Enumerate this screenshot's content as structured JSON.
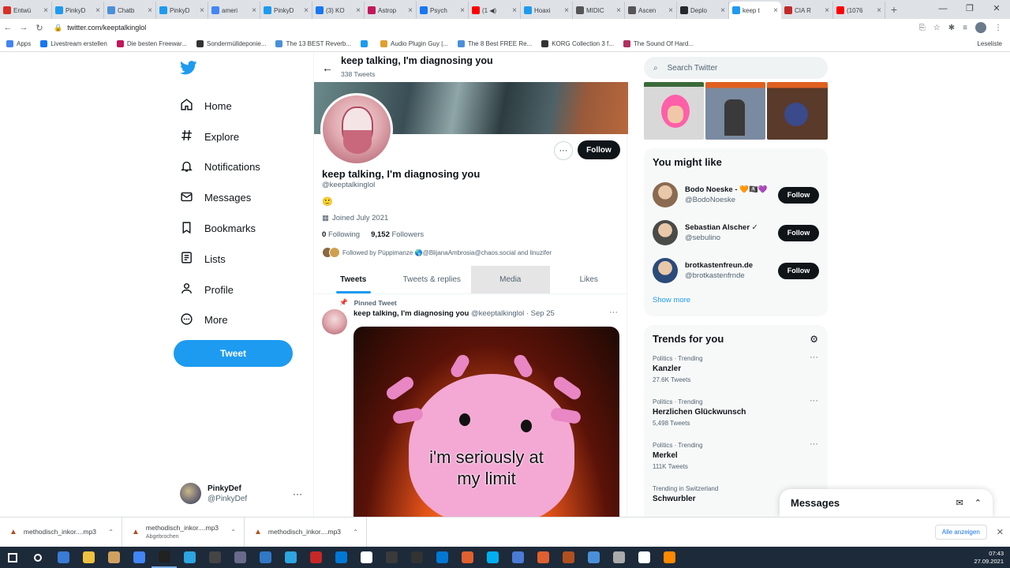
{
  "browser": {
    "tabs": [
      {
        "title": "Entwü",
        "color": "#d93025"
      },
      {
        "title": "PinkyD",
        "color": "#1d9bf0"
      },
      {
        "title": "Chatb",
        "color": "#4a90d9"
      },
      {
        "title": "PinkyD",
        "color": "#1d9bf0"
      },
      {
        "title": "ameri",
        "color": "#4285f4"
      },
      {
        "title": "PinkyD",
        "color": "#1d9bf0"
      },
      {
        "title": "(3) KO",
        "color": "#1877f2"
      },
      {
        "title": "Astrop",
        "color": "#c2185b"
      },
      {
        "title": "Psych",
        "color": "#1877f2"
      },
      {
        "title": "(1 ◀)",
        "color": "#ff0000"
      },
      {
        "title": "Hoaxi",
        "color": "#1d9bf0"
      },
      {
        "title": "MIDIC",
        "color": "#555555"
      },
      {
        "title": "Ascen",
        "color": "#555555"
      },
      {
        "title": "Deplo",
        "color": "#24292f"
      },
      {
        "title": "keep t",
        "color": "#1d9bf0",
        "active": true
      },
      {
        "title": "CIA R",
        "color": "#c62828"
      },
      {
        "title": "(1076",
        "color": "#ff0000"
      }
    ],
    "url": "twitter.com/keeptalkinglol",
    "bookmarks": [
      {
        "label": "Apps",
        "color": "#4285f4"
      },
      {
        "label": "Livestream erstellen",
        "color": "#1877f2"
      },
      {
        "label": "Die besten Freewar...",
        "color": "#c2185b"
      },
      {
        "label": "Sondermülldeponie...",
        "color": "#333333"
      },
      {
        "label": "The 13 BEST Reverb...",
        "color": "#4a90d9"
      },
      {
        "label": "",
        "color": "#1d9bf0"
      },
      {
        "label": "Audio Plugin Guy |...",
        "color": "#e0a030"
      },
      {
        "label": "The 8 Best FREE Re...",
        "color": "#4a90d9"
      },
      {
        "label": "KORG Collection 3 f...",
        "color": "#333333"
      },
      {
        "label": "The Sound Of Hard...",
        "color": "#b03060"
      }
    ],
    "reading_list": "Leseliste"
  },
  "nav": {
    "items": [
      {
        "label": "Home",
        "icon": "home-icon"
      },
      {
        "label": "Explore",
        "icon": "hashtag-icon"
      },
      {
        "label": "Notifications",
        "icon": "bell-icon"
      },
      {
        "label": "Messages",
        "icon": "envelope-icon"
      },
      {
        "label": "Bookmarks",
        "icon": "bookmark-icon"
      },
      {
        "label": "Lists",
        "icon": "list-icon"
      },
      {
        "label": "Profile",
        "icon": "person-icon"
      },
      {
        "label": "More",
        "icon": "more-circle-icon"
      }
    ],
    "tweet_label": "Tweet",
    "account": {
      "name": "PinkyDef",
      "handle": "@PinkyDef",
      "more": "···"
    }
  },
  "profile": {
    "header_title": "keep talking, I'm diagnosing you",
    "header_count": "338 Tweets",
    "name": "keep talking, I'm diagnosing you",
    "handle": "@keeptalkinglol",
    "bio": "🙂",
    "joined": "Joined July 2021",
    "following_count": "0",
    "following_label": "Following",
    "followers_count": "9,152",
    "followers_label": "Followers",
    "followed_by": "Followed by Püppimanze 🌎@BlijanaAmbrosia@chaos.social and linuzifer",
    "follow_label": "Follow",
    "more_label": "···",
    "tabs": [
      "Tweets",
      "Tweets & replies",
      "Media",
      "Likes"
    ]
  },
  "tweet": {
    "pinned_label": "Pinned Tweet",
    "author": "keep talking, I'm diagnosing you",
    "handle": "@keeptalkinglol",
    "date": "· Sep 25",
    "more": "···",
    "image_caption_line1": "i'm seriously at",
    "image_caption_line2": "my limit"
  },
  "sidebar": {
    "search_placeholder": "Search Twitter",
    "you_might_like_title": "You might like",
    "suggestions": [
      {
        "name": "Bodo Noeske - 🧡🏴‍☠️💜",
        "handle": "@BodoNoeske",
        "avatar_color": "#8a6a50"
      },
      {
        "name": "Sebastian Alscher ✓",
        "handle": "@sebulino",
        "avatar_color": "#4a4a48"
      },
      {
        "name": "brotkastenfreun.de",
        "handle": "@brotkastenfrnde",
        "avatar_color": "#2a4a7a"
      }
    ],
    "follow_label": "Follow",
    "show_more": "Show more",
    "trends_title": "Trends for you",
    "trends": [
      {
        "category": "Politics · Trending",
        "name": "Kanzler",
        "count": "27.6K Tweets"
      },
      {
        "category": "Politics · Trending",
        "name": "Herzlichen Glückwunsch",
        "count": "5,498 Tweets"
      },
      {
        "category": "Politics · Trending",
        "name": "Merkel",
        "count": "111K Tweets"
      },
      {
        "category": "Trending in Switzerland",
        "name": "Schwurbler",
        "count": ""
      }
    ],
    "messages_title": "Messages"
  },
  "downloads": {
    "items": [
      {
        "name": "methodisch_inkor....mp3",
        "status": ""
      },
      {
        "name": "methodisch_inkor....mp3",
        "status": "Abgebrochen"
      },
      {
        "name": "methodisch_inkor....mp3",
        "status": ""
      }
    ],
    "show_all": "Alle anzeigen"
  },
  "taskbar": {
    "time": "07:43",
    "date": "27.09.2021",
    "icons": [
      "#ffffff",
      "#ffffff",
      "#3a7bd5",
      "#f0c040",
      "#d0a060",
      "#4285f4",
      "#222222",
      "#2ca5e0",
      "#444444",
      "#6a6a8a",
      "#3178c6",
      "#2ca5e0",
      "#c62828",
      "#0078d4",
      "#ffffff",
      "#3a3a3a",
      "#333333",
      "#0078d4",
      "#e06030",
      "#00aff0",
      "#4a7bd5",
      "#e06030",
      "#b05020",
      "#4a90d9",
      "#aaaaaa",
      "#ffffff",
      "#ff8800"
    ]
  }
}
